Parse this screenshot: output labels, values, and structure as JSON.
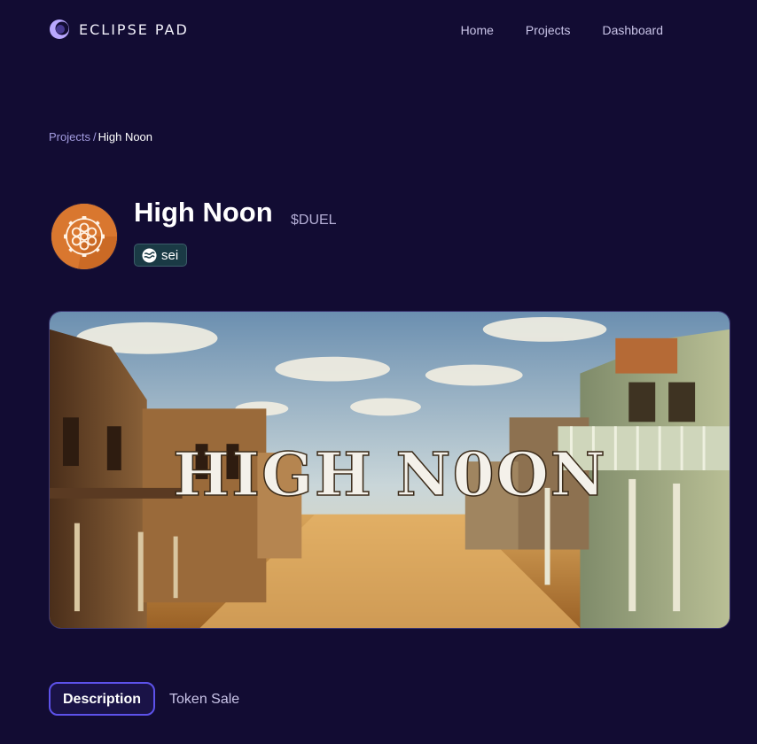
{
  "header": {
    "brand": "ECLIPSE PAD",
    "logo_icon": "eclipse-moon-icon",
    "nav": [
      {
        "label": "Home"
      },
      {
        "label": "Projects"
      },
      {
        "label": "Dashboard"
      }
    ]
  },
  "breadcrumb": {
    "parent": "Projects",
    "separator": "/",
    "current": "High Noon"
  },
  "project": {
    "name": "High Noon",
    "ticker": "$DUEL",
    "logo_icon": "revolver-cylinder-icon",
    "chain": {
      "label": "sei",
      "icon": "sei-logo-icon"
    },
    "banner_title": "HIGH N0ON"
  },
  "tabs": [
    {
      "label": "Description",
      "active": true
    },
    {
      "label": "Token Sale",
      "active": false
    }
  ],
  "colors": {
    "background": "#120c33",
    "accent": "#5d52ea",
    "logo_orange": "#d9772f",
    "chain_badge": "#1a3a45"
  }
}
